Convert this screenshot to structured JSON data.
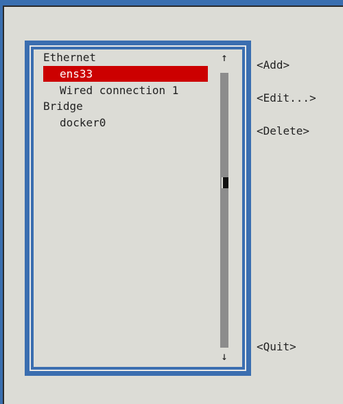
{
  "connections": {
    "items": [
      {
        "label": "Ethernet",
        "indent": 0,
        "selected": false
      },
      {
        "label": "ens33",
        "indent": 1,
        "selected": true
      },
      {
        "label": "Wired connection 1",
        "indent": 1,
        "selected": false
      },
      {
        "label": "Bridge",
        "indent": 0,
        "selected": false
      },
      {
        "label": "docker0",
        "indent": 1,
        "selected": false
      }
    ]
  },
  "scrollbar": {
    "up_arrow": "↑",
    "down_arrow": "↓"
  },
  "buttons": {
    "add": "<Add>",
    "edit": "<Edit...>",
    "delete": "<Delete>",
    "quit": "<Quit>"
  },
  "colors": {
    "background": "#dcdcd6",
    "frame": "#3b6eb0",
    "selection": "#cc0000",
    "scroll_track": "#8c8c8c"
  }
}
